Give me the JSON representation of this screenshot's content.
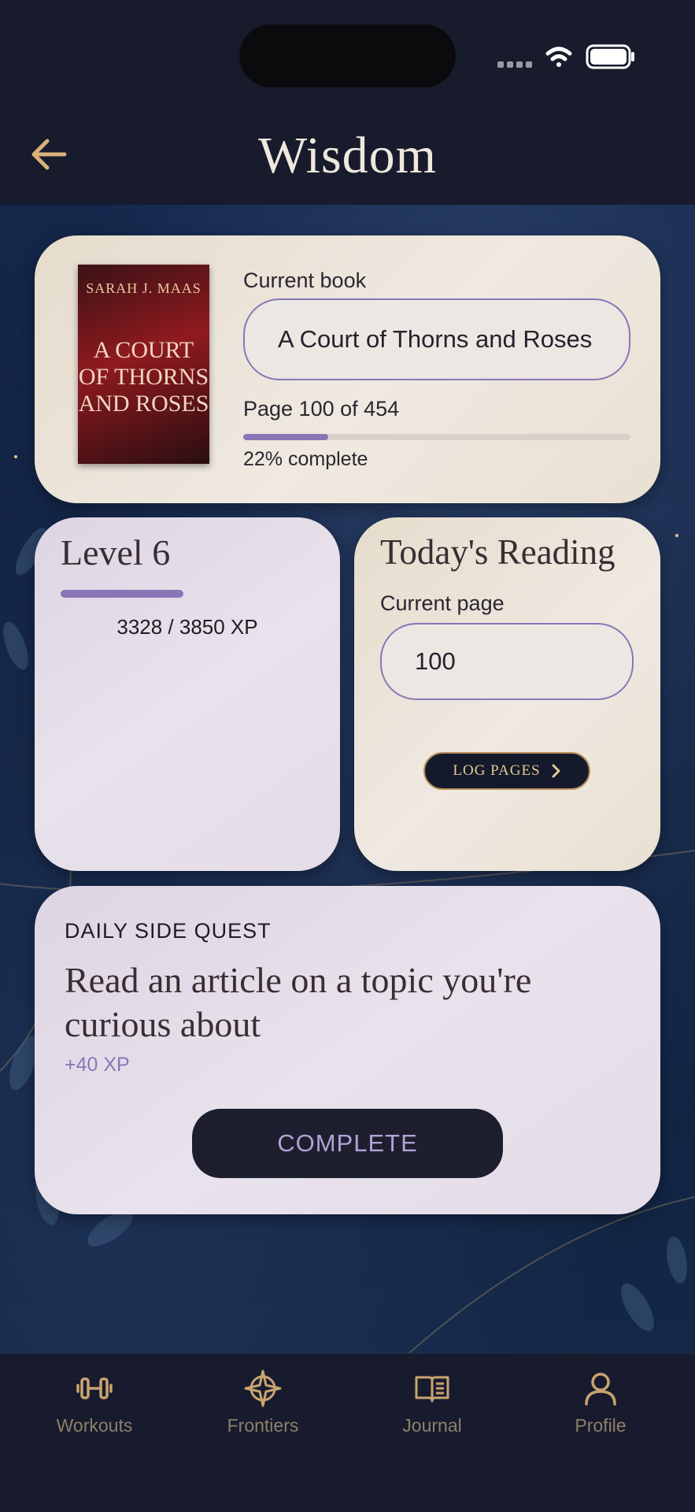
{
  "header": {
    "title": "Wisdom"
  },
  "book": {
    "cover_author": "SARAH J. MAAS",
    "cover_title_lines": [
      "A COURT",
      "OF THORNS",
      "AND ROSES"
    ],
    "current_book_label": "Current book",
    "current_book_value": "A Court of Thorns and Roses",
    "page_text": "Page 100 of 454",
    "progress_fraction": 0.22,
    "complete_text": "22% complete"
  },
  "level": {
    "title": "Level 6",
    "xp_text": "3328 / 3850 XP"
  },
  "reading": {
    "title": "Today's Reading",
    "current_page_label": "Current page",
    "current_page_value": "100",
    "log_button_label": "LOG PAGES"
  },
  "quest": {
    "label": "DAILY SIDE QUEST",
    "text": "Read an article on a topic you're curious about",
    "xp": "+40 XP",
    "complete_label": "COMPLETE"
  },
  "tabs": [
    {
      "label": "Workouts",
      "icon": "dumbbell-icon"
    },
    {
      "label": "Frontiers",
      "icon": "compass-icon"
    },
    {
      "label": "Journal",
      "icon": "book-icon"
    },
    {
      "label": "Profile",
      "icon": "profile-icon"
    }
  ],
  "colors": {
    "accent": "#8a76b6",
    "gold": "#d9b27c",
    "navy": "#171b2c"
  }
}
